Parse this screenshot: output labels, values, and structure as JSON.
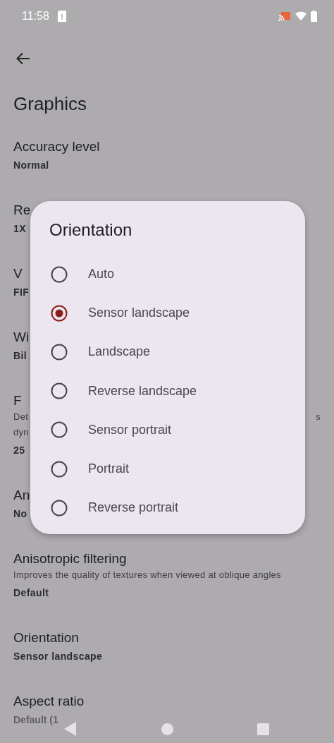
{
  "status_bar": {
    "time": "11:58"
  },
  "app_bar": {
    "title": "Graphics"
  },
  "settings": [
    {
      "title": "Accuracy level",
      "value": "Normal"
    },
    {
      "title": "Re",
      "value": "1X"
    },
    {
      "title": "V",
      "value": "FIF"
    },
    {
      "title": "Wi",
      "value": "Bil"
    },
    {
      "title": "F",
      "description": [
        "Det",
        "dyn"
      ],
      "description_tail": "s",
      "value": "25"
    },
    {
      "title": "An",
      "value": "No"
    },
    {
      "title": "Anisotropic filtering",
      "description": [
        "Improves the quality of textures when viewed at oblique angles"
      ],
      "value": "Default"
    },
    {
      "title": "Orientation",
      "value": "Sensor landscape"
    },
    {
      "title": "Aspect ratio",
      "value": "Default (1",
      "disabled": true
    }
  ],
  "dialog": {
    "title": "Orientation",
    "options": [
      {
        "label": "Auto",
        "selected": false
      },
      {
        "label": "Sensor landscape",
        "selected": true
      },
      {
        "label": "Landscape",
        "selected": false
      },
      {
        "label": "Reverse landscape",
        "selected": false
      },
      {
        "label": "Sensor portrait",
        "selected": false
      },
      {
        "label": "Portrait",
        "selected": false
      },
      {
        "label": "Reverse portrait",
        "selected": false
      }
    ]
  }
}
